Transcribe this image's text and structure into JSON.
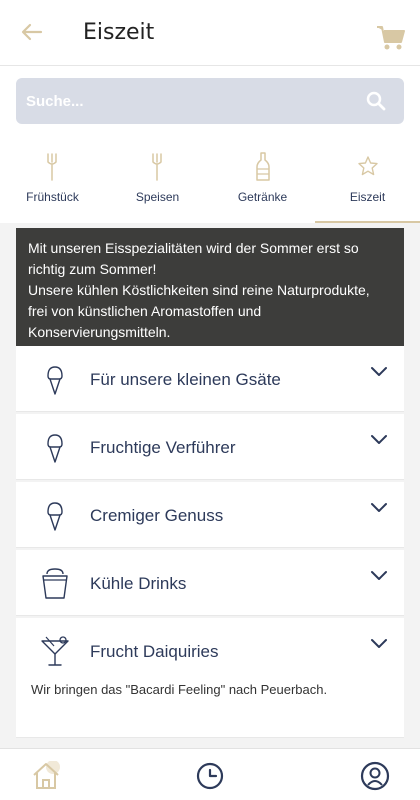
{
  "header": {
    "title": "Eiszeit",
    "back_icon": "back-arrow-icon",
    "cart_icon": "cart-icon"
  },
  "search": {
    "placeholder": "Suche..."
  },
  "tabs": [
    {
      "label": "Frühstück",
      "icon": "cutlery-icon",
      "active": false
    },
    {
      "label": "Speisen",
      "icon": "cutlery-icon",
      "active": false
    },
    {
      "label": "Getränke",
      "icon": "bottle-icon",
      "active": false
    },
    {
      "label": "Eiszeit",
      "icon": "star-icon",
      "active": true
    }
  ],
  "banner": {
    "line1": "Mit unseren Eisspezialitäten wird der Sommer erst so richtig zum Sommer!",
    "line2": "Unsere kühlen Köstlichkeiten sind reine Naturprodukte, frei von  künstlichen Aromastoffen und Konservierungsmitteln."
  },
  "categories": [
    {
      "label": "Für unsere kleinen Gsäte",
      "icon": "ice-cream-icon"
    },
    {
      "label": "Fruchtige Verführer",
      "icon": "ice-cream-icon"
    },
    {
      "label": "Cremiger Genuss",
      "icon": "ice-cream-icon"
    },
    {
      "label": "Kühle Drinks",
      "icon": "bucket-icon"
    },
    {
      "label": "Frucht Daiquiries",
      "icon": "cocktail-icon",
      "description": "Wir bringen das \"Bacardi Feeling\" nach Peuerbach."
    }
  ],
  "colors": {
    "accent": "#d8c8a4",
    "text": "#2d3a5a",
    "banner_bg": "#3d3d3b",
    "search_bg": "#d8dce6"
  },
  "bottom_nav": [
    {
      "icon": "home-icon",
      "active": true
    },
    {
      "icon": "clock-icon",
      "active": false
    },
    {
      "icon": "profile-icon",
      "active": false
    }
  ]
}
